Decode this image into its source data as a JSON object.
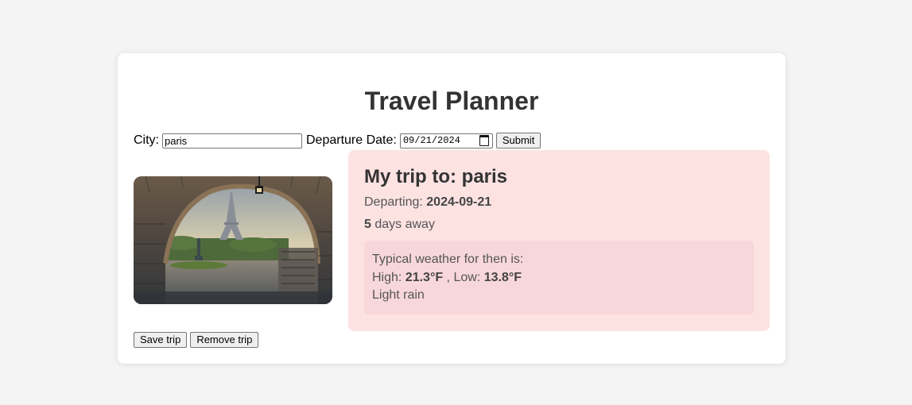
{
  "app": {
    "title": "Travel Planner"
  },
  "form": {
    "city_label": "City:",
    "city_value": "paris",
    "date_label": "Departure Date:",
    "date_display": "09/21/2024",
    "submit_label": "Submit"
  },
  "trip": {
    "title_prefix": "My trip to: ",
    "city": "paris",
    "departing_label": "Departing: ",
    "departing_date": "2024-09-21",
    "days_count": "5",
    "days_suffix": " days away"
  },
  "weather": {
    "intro": "Typical weather for then is:",
    "high_label": "High: ",
    "high_value": "21.3°F",
    "low_label": " , Low: ",
    "low_value": "13.8°F",
    "description": "Light rain"
  },
  "actions": {
    "save_label": "Save trip",
    "remove_label": "Remove trip"
  },
  "photo": {
    "subject": "Eiffel Tower seen through a stone bridge arch"
  },
  "colors": {
    "page_bg": "#f4f4f4",
    "card_bg": "#ffffff",
    "trip_panel_bg": "#fde2e2",
    "weather_box_bg": "#f8d7da"
  }
}
